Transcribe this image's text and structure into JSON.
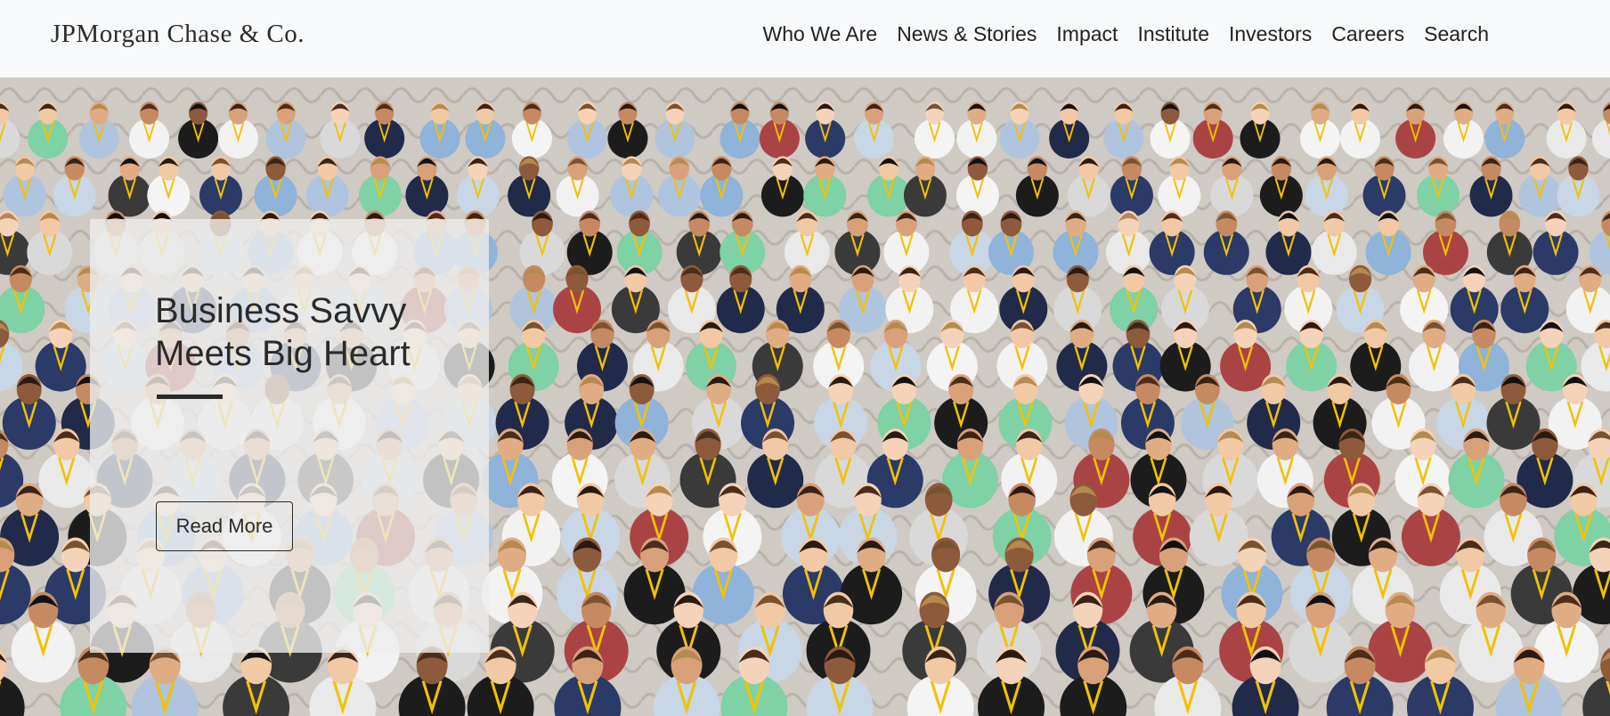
{
  "header": {
    "logo_text": "JPMorgan Chase & Co.",
    "nav": [
      "Who We Are",
      "News & Stories",
      "Impact",
      "Institute",
      "Investors",
      "Careers",
      "Search"
    ]
  },
  "hero": {
    "image": "crowd-photo",
    "title_line1": "Business Savvy",
    "title_line2": "Meets Big Heart",
    "cta_label": "Read More"
  },
  "colors": {
    "lanyard": "#f2c200",
    "carpet_teal": "#1f8fae",
    "header_bg": "#f8f9fa"
  }
}
